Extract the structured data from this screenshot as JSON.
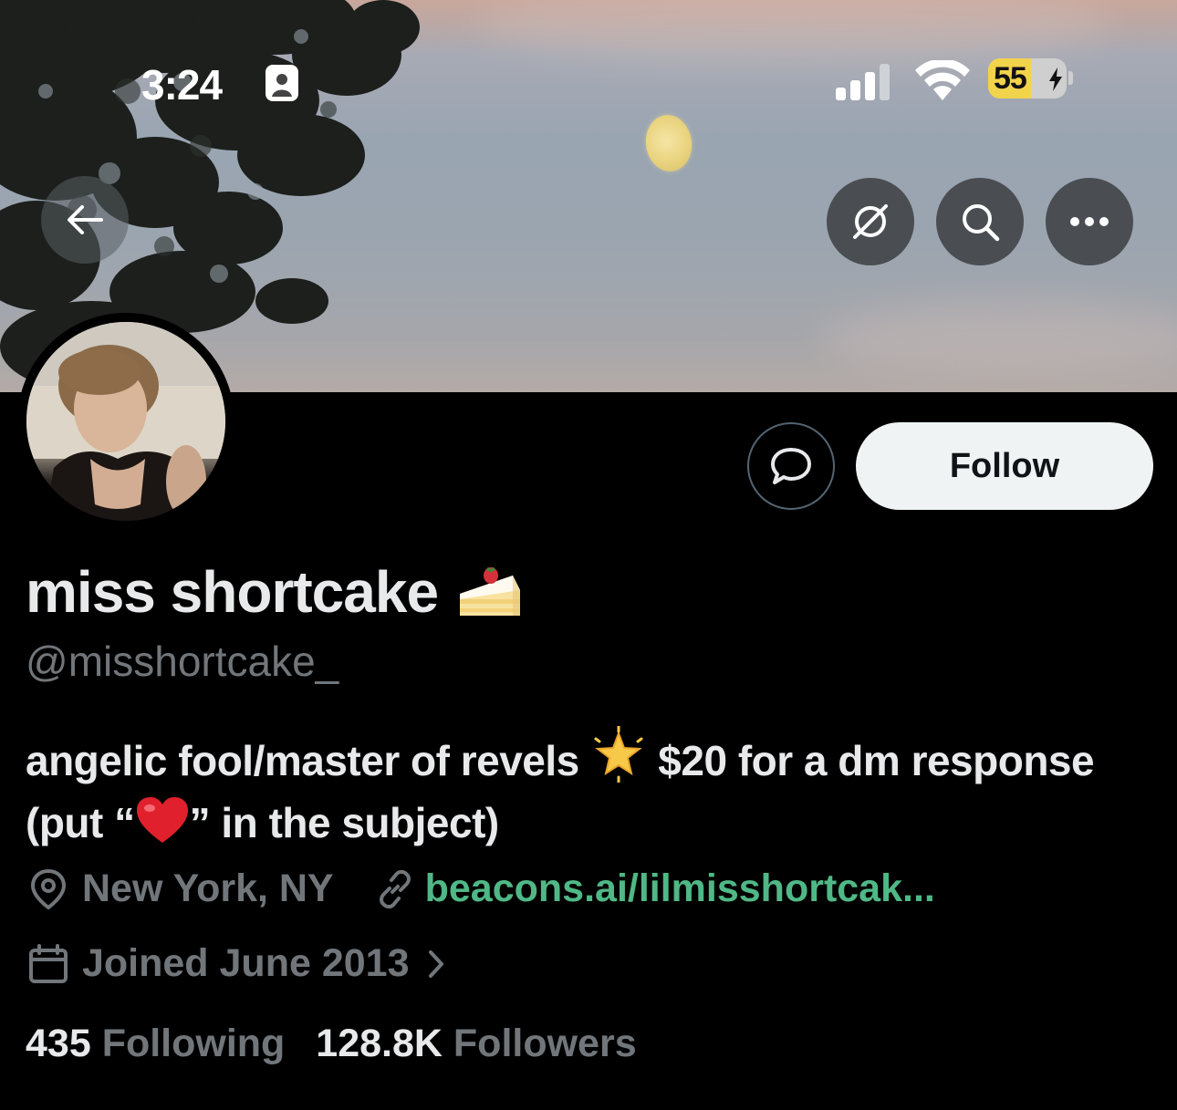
{
  "status_bar": {
    "time": "3:24",
    "battery_level": "55",
    "battery_fill_fraction": 0.55,
    "battery_color": "#f2d34c"
  },
  "nav": {
    "back_icon": "arrow-left-icon",
    "translate_icon": "no-translate-icon",
    "search_icon": "search-icon",
    "more_icon": "more-icon"
  },
  "profile": {
    "display_name": "miss shortcake",
    "display_name_emoji": "shortcake-emoji",
    "handle": "@misshortcake_",
    "bio_part1": "angelic fool/master of revels",
    "bio_part2": "$20 for a dm response (put “",
    "bio_part3": "” in the subject)",
    "location": "New York, NY",
    "website": "beacons.ai/lilmisshortcak...",
    "joined": "Joined June 2013",
    "following_count": "435",
    "following_label": "Following",
    "followers_count": "128.8K",
    "followers_label": "Followers"
  },
  "actions": {
    "follow_label": "Follow",
    "message_icon": "message-icon"
  },
  "colors": {
    "link": "#4fb886",
    "muted": "#71767b",
    "text": "#e7e9ea",
    "follow_bg": "#eff3f4"
  }
}
